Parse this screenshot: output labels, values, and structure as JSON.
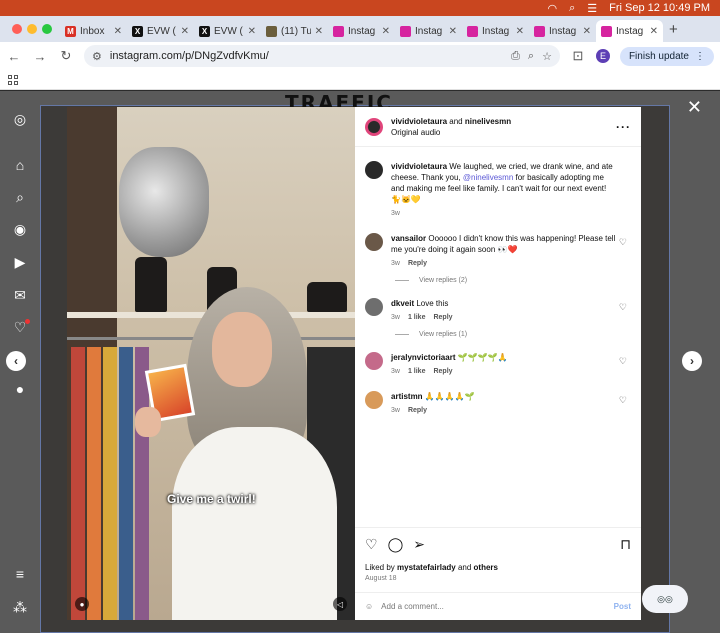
{
  "menubar": {
    "datetime": "Fri Sep 12  10:49 PM"
  },
  "tabs": [
    {
      "title": "Inbox",
      "favicon_color": "#d93025",
      "favicon_glyph": "M"
    },
    {
      "title": "EVW (",
      "favicon_color": "#111111",
      "favicon_glyph": "X"
    },
    {
      "title": "EVW (",
      "favicon_color": "#111111",
      "favicon_glyph": "X"
    },
    {
      "title": "(11) Tu",
      "favicon_color": "#6b5e3c",
      "favicon_glyph": ""
    },
    {
      "title": "Instag",
      "favicon_color": "#d6249f",
      "favicon_glyph": ""
    },
    {
      "title": "Instag",
      "favicon_color": "#d6249f",
      "favicon_glyph": ""
    },
    {
      "title": "Instag",
      "favicon_color": "#d6249f",
      "favicon_glyph": ""
    },
    {
      "title": "Instag",
      "favicon_color": "#d6249f",
      "favicon_glyph": ""
    },
    {
      "title": "Instag",
      "favicon_color": "#d6249f",
      "favicon_glyph": "",
      "active": true
    }
  ],
  "toolbar": {
    "url": "instagram.com/p/DNgZvdfvKmu/",
    "profile_initial": "E",
    "update_label": "Finish update"
  },
  "background": {
    "sign_text": "TRAFFIC"
  },
  "caption": "Give me a twirl!",
  "post": {
    "author": "vividvioletaura",
    "coauthor": "ninelivesmn",
    "and_label": "and",
    "audio": "Original audio",
    "caption_author": "vividvioletaura",
    "caption_before": " We laughed, we cried, we drank wine, and ate cheese. Thank you, ",
    "caption_mention": "@ninelivesmn",
    "caption_after": " for basically adopting me and making me feel like family. I can't wait for our next event! 🐈🐱💛",
    "caption_age": "3w"
  },
  "comments": [
    {
      "user": "vansailor",
      "text": " Oooooo I didn't know this was happening! Please tell me you're doing it again soon 👀❤️",
      "age": "3w",
      "likes": "",
      "reply": "Reply",
      "view_replies": "View replies (2)",
      "avatar_color": "#6a5848"
    },
    {
      "user": "dkveit",
      "text": " Love this",
      "age": "3w",
      "likes": "1 like",
      "reply": "Reply",
      "view_replies": "View replies (1)",
      "avatar_color": "#6e6e6e"
    },
    {
      "user": "jeralynvictoriaart",
      "text": " 🌱🌱🌱🌱🙏",
      "age": "3w",
      "likes": "1 like",
      "reply": "Reply",
      "view_replies": "",
      "avatar_color": "#c46a8a"
    },
    {
      "user": "artistmn",
      "text": " 🙏🙏🙏🙏🌱",
      "age": "3w",
      "likes": "",
      "reply": "Reply",
      "view_replies": "",
      "avatar_color": "#d89a5a"
    }
  ],
  "likes": {
    "prefix": "Liked by ",
    "user": "mystatefairlady",
    "middle": " and ",
    "others": "others"
  },
  "post_date": "August 18",
  "comment_box": {
    "placeholder": "Add a comment...",
    "post_label": "Post"
  },
  "colors": {
    "menubar": "#c9461f",
    "link": "#5b58d6",
    "accent": "#0095f6"
  }
}
